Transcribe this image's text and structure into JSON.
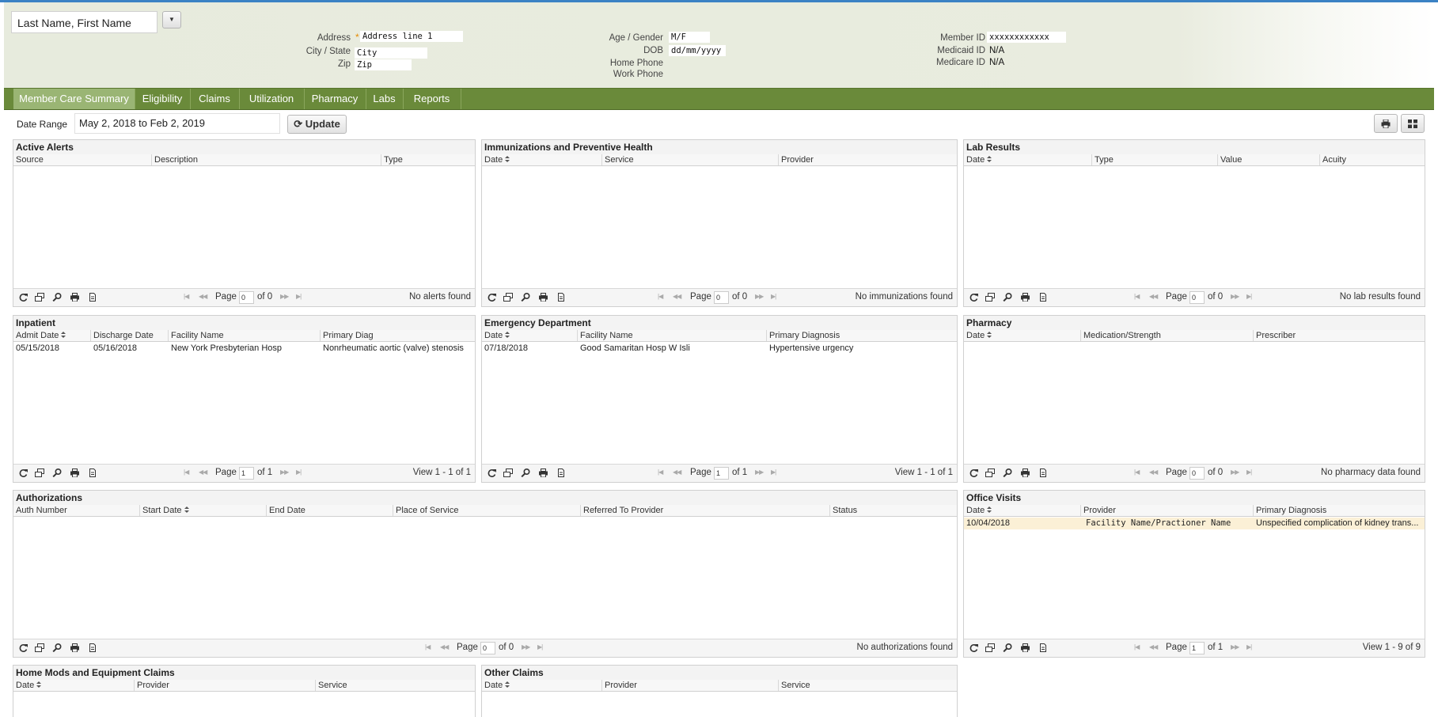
{
  "member": {
    "name": "Last Name, First Name",
    "address_label": "Address",
    "address_value": "Address line 1",
    "city_state_label": "City / State",
    "city_value": "City",
    "zip_label": "Zip",
    "zip_value": "Zip",
    "age_gender_label": "Age / Gender",
    "age_gender_value": "M/F",
    "dob_label": "DOB",
    "dob_value": "dd/mm/yyyy",
    "home_phone_label": "Home Phone",
    "work_phone_label": "Work Phone",
    "member_id_label": "Member ID",
    "member_id_value": "xxxxxxxxxxxx",
    "medicaid_label": "Medicaid ID",
    "medicaid_value": "N/A",
    "medicare_label": "Medicare ID",
    "medicare_value": "N/A"
  },
  "tabs": [
    "Member Care Summary",
    "Eligibility",
    "Claims",
    "Utilization",
    "Pharmacy",
    "Labs",
    "Reports"
  ],
  "toolbar": {
    "date_range_label": "Date Range",
    "date_range_value": "May 2, 2018 to Feb 2, 2019",
    "update_label": "Update"
  },
  "panels": {
    "alerts": {
      "title": "Active Alerts",
      "columns": [
        "Source",
        "Description",
        "Type"
      ],
      "rows": [],
      "page_label": "Page",
      "page_value": "0",
      "page_of": "of 0",
      "status": "No alerts found"
    },
    "immunizations": {
      "title": "Immunizations and Preventive Health",
      "columns": [
        "Date",
        "Service",
        "Provider"
      ],
      "rows": [],
      "page_label": "Page",
      "page_value": "0",
      "page_of": "of 0",
      "status": "No immunizations found"
    },
    "labs": {
      "title": "Lab Results",
      "columns": [
        "Date",
        "Type",
        "Value",
        "Acuity"
      ],
      "rows": [],
      "page_label": "Page",
      "page_value": "0",
      "page_of": "of 0",
      "status": "No lab results found"
    },
    "inpatient": {
      "title": "Inpatient",
      "columns": [
        "Admit Date",
        "Discharge Date",
        "Facility Name",
        "Primary Diag"
      ],
      "rows": [
        [
          "05/15/2018",
          "05/16/2018",
          "New York Presbyterian Hosp",
          "Nonrheumatic aortic (valve) stenosis"
        ]
      ],
      "page_label": "Page",
      "page_value": "1",
      "page_of": "of 1",
      "status": "View 1 - 1 of 1"
    },
    "emergency": {
      "title": "Emergency Department",
      "columns": [
        "Date",
        "Facility Name",
        "Primary Diagnosis"
      ],
      "rows": [
        [
          "07/18/2018",
          "Good Samaritan Hosp W Isli",
          "Hypertensive urgency"
        ]
      ],
      "page_label": "Page",
      "page_value": "1",
      "page_of": "of 1",
      "status": "View 1 - 1 of 1"
    },
    "pharmacy": {
      "title": "Pharmacy",
      "columns": [
        "Date",
        "Medication/Strength",
        "Prescriber"
      ],
      "rows": [],
      "page_label": "Page",
      "page_value": "0",
      "page_of": "of 0",
      "status": "No pharmacy data found"
    },
    "authorizations": {
      "title": "Authorizations",
      "columns": [
        "Auth Number",
        "Start Date",
        "End Date",
        "Place of Service",
        "Referred To Provider",
        "Status"
      ],
      "rows": [],
      "page_label": "Page",
      "page_value": "0",
      "page_of": "of 0",
      "status": "No authorizations found"
    },
    "office_visits": {
      "title": "Office Visits",
      "columns": [
        "Date",
        "Provider",
        "Primary Diagnosis"
      ],
      "rows": [
        [
          "10/04/2018",
          "Facility Name/Practioner Name",
          "Unspecified complication of kidney trans..."
        ]
      ],
      "page_label": "Page",
      "page_value": "1",
      "page_of": "of 1",
      "status": "View 1 - 9 of 9"
    },
    "home_mods": {
      "title": "Home Mods and Equipment Claims",
      "columns": [
        "Date",
        "Provider",
        "Service"
      ],
      "rows": []
    },
    "other_claims": {
      "title": "Other Claims",
      "columns": [
        "Date",
        "Provider",
        "Service"
      ],
      "rows": []
    }
  },
  "colors": {
    "nav_bar": "#6a8a3a",
    "active_tab": "#9ab574",
    "header_bg": "#e7ebdd",
    "required_star": "#e68a00",
    "row_highlight": "#fbf0d6"
  },
  "icons": {
    "pager_tools": [
      "refresh-icon",
      "columns-icon",
      "search-icon",
      "print-icon",
      "export-icon"
    ],
    "toolbar_right": [
      "print-icon",
      "grid-icon"
    ]
  }
}
